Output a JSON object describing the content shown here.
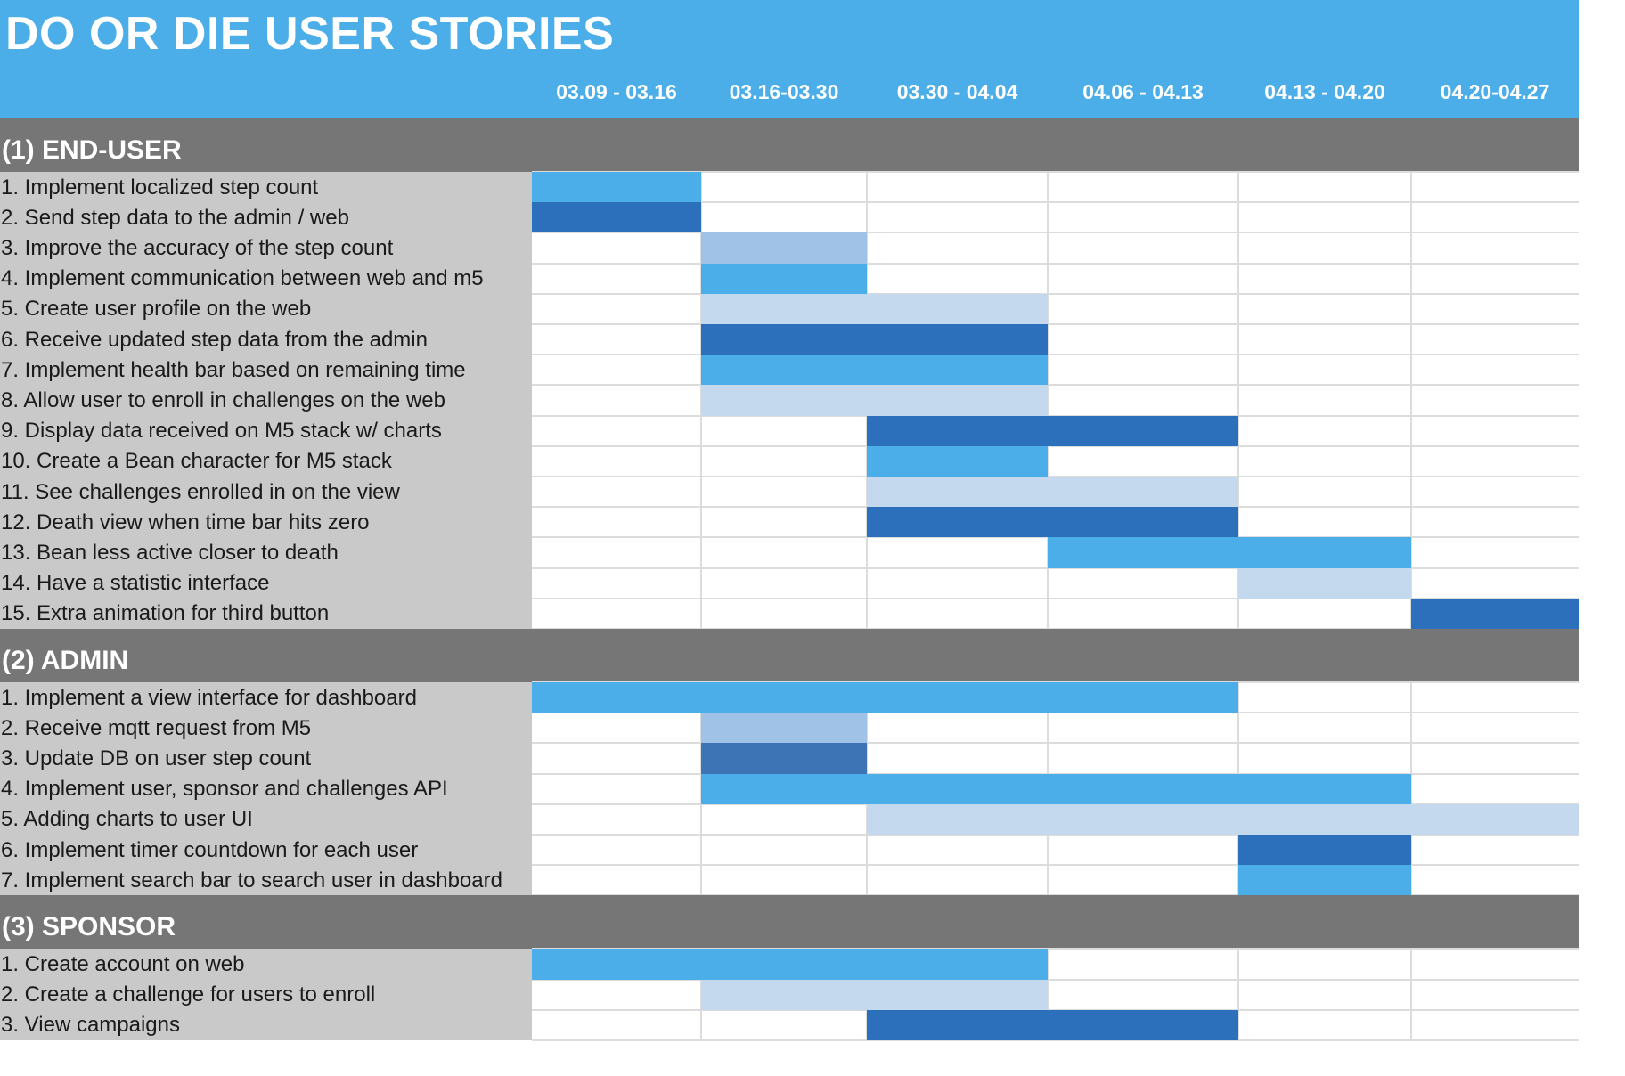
{
  "page": {
    "title": "DO OR DIE USER STORIES"
  },
  "colors": {
    "header": "#4caee8",
    "section_band": "#767676",
    "label_bg": "#c9c9c9",
    "sky": "#4caee8",
    "navy": "#2c6fbb",
    "steel": "#3d74b5",
    "pale": "#9fc2e6",
    "ice": "#c4d8ee"
  },
  "chart_data": {
    "type": "gantt",
    "title": "DO OR DIE USER STORIES",
    "periods": [
      "03.09 - 03.16",
      "03.16-03.30",
      "03.30 - 04.04",
      "04.06 - 04.13",
      "04.13 - 04.20",
      "04.20-04.27"
    ],
    "sections": [
      {
        "name": "(1) END-USER",
        "tasks": [
          {
            "label": "1. Implement localized step count",
            "start": 0,
            "end": 1,
            "color": "sky"
          },
          {
            "label": "2. Send step data to the admin / web",
            "start": 0,
            "end": 1,
            "color": "navy"
          },
          {
            "label": "3. Improve the accuracy of the step count",
            "start": 1,
            "end": 2,
            "color": "pale"
          },
          {
            "label": "4. Implement communication between web and m5",
            "start": 1,
            "end": 2,
            "color": "sky"
          },
          {
            "label": "5. Create user profile on the web",
            "start": 1,
            "end": 3,
            "color": "ice"
          },
          {
            "label": "6. Receive updated step data from the admin",
            "start": 1,
            "end": 3,
            "color": "navy"
          },
          {
            "label": "7. Implement health bar based on remaining time",
            "start": 1,
            "end": 3,
            "color": "sky"
          },
          {
            "label": "8. Allow user to enroll in challenges on the web",
            "start": 1,
            "end": 3,
            "color": "ice"
          },
          {
            "label": "9. Display data received on M5 stack w/ charts",
            "start": 2,
            "end": 4,
            "color": "navy"
          },
          {
            "label": "10. Create a Bean character for M5 stack",
            "start": 2,
            "end": 3,
            "color": "sky"
          },
          {
            "label": "11. See challenges enrolled in on the view",
            "start": 2,
            "end": 4,
            "color": "ice"
          },
          {
            "label": "12. Death view when time bar hits zero",
            "start": 2,
            "end": 4,
            "color": "navy"
          },
          {
            "label": "13. Bean less active closer to death",
            "start": 3,
            "end": 5,
            "color": "sky"
          },
          {
            "label": "14. Have a statistic interface",
            "start": 4,
            "end": 5,
            "color": "ice"
          },
          {
            "label": "15. Extra animation for third button",
            "start": 5,
            "end": 6,
            "color": "navy"
          }
        ]
      },
      {
        "name": "(2) ADMIN",
        "tasks": [
          {
            "label": "1. Implement a view interface for dashboard",
            "start": 0,
            "end": 4,
            "color": "sky"
          },
          {
            "label": "2. Receive mqtt request from M5",
            "start": 1,
            "end": 2,
            "color": "pale"
          },
          {
            "label": "3. Update DB on user step count",
            "start": 1,
            "end": 2,
            "color": "steel"
          },
          {
            "label": "4. Implement user, sponsor and challenges API",
            "start": 1,
            "end": 5,
            "color": "sky"
          },
          {
            "label": " 5. Adding charts to user UI",
            "start": 2,
            "end": 6,
            "color": "ice"
          },
          {
            "label": "6. Implement timer countdown for each user",
            "start": 4,
            "end": 5,
            "color": "navy"
          },
          {
            "label": "7. Implement search bar to search user in dashboard",
            "start": 4,
            "end": 5,
            "color": "sky"
          }
        ]
      },
      {
        "name": "(3) SPONSOR",
        "tasks": [
          {
            "label": "1. Create account on web",
            "start": 0,
            "end": 3,
            "color": "sky"
          },
          {
            "label": "2. Create a challenge for users to enroll",
            "start": 1,
            "end": 3,
            "color": "ice"
          },
          {
            "label": "3. View campaigns",
            "start": 2,
            "end": 4,
            "color": "navy"
          }
        ]
      }
    ]
  }
}
